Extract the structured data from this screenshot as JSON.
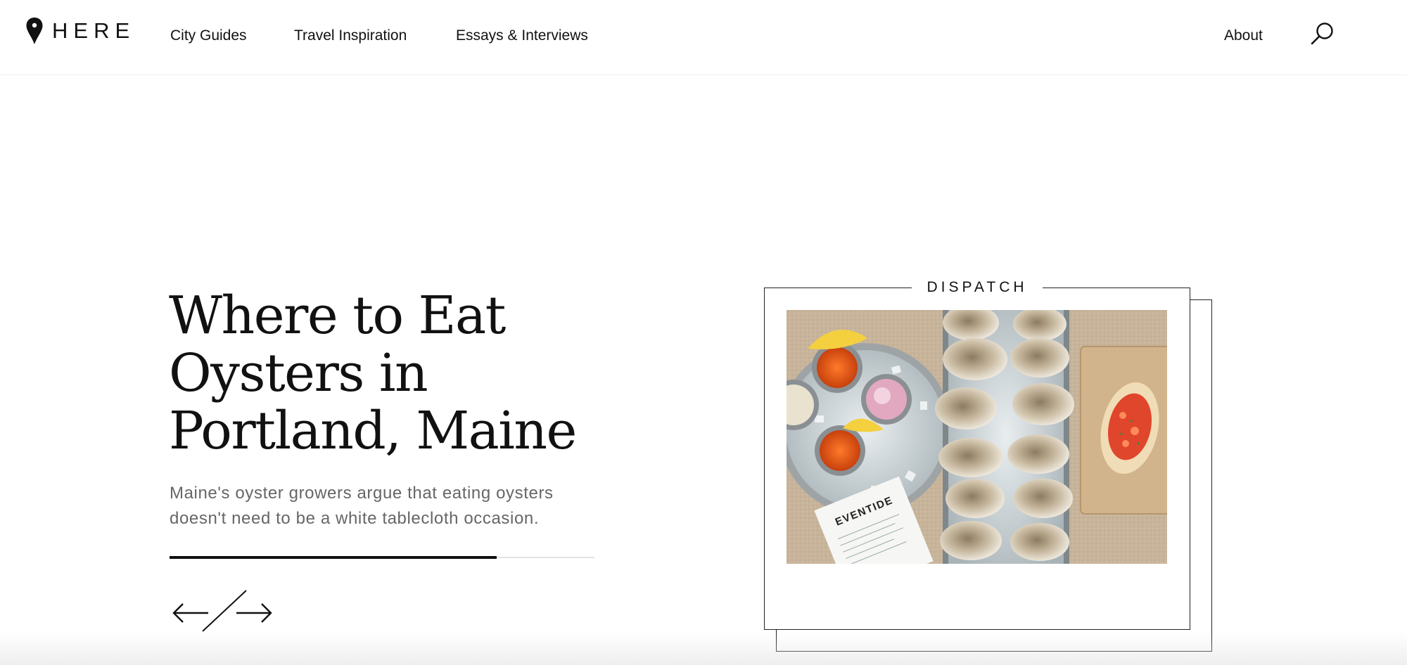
{
  "brand": {
    "logo_text": "HERE"
  },
  "nav": {
    "items": [
      {
        "label": "City Guides"
      },
      {
        "label": "Travel Inspiration"
      },
      {
        "label": "Essays & Interviews"
      }
    ],
    "about_label": "About",
    "search_icon": "search-icon"
  },
  "hero": {
    "title": "Where to Eat Oysters in Portland, Maine",
    "dek": "Maine's oyster growers argue that eating oysters doesn't need to be a white tablecloth occasion.",
    "progress": 0.77,
    "prev_icon": "arrow-left-icon",
    "next_icon": "arrow-right-icon"
  },
  "card": {
    "kicker": "DISPATCH",
    "image_alt": "Platter of oysters on ice with mignonette cups, lemon wedges and an Eventide menu",
    "menu_text": "EVENTIDE"
  },
  "colors": {
    "text": "#111111",
    "dek": "#666666",
    "border": "#222222",
    "track": "#e4e4e4"
  }
}
